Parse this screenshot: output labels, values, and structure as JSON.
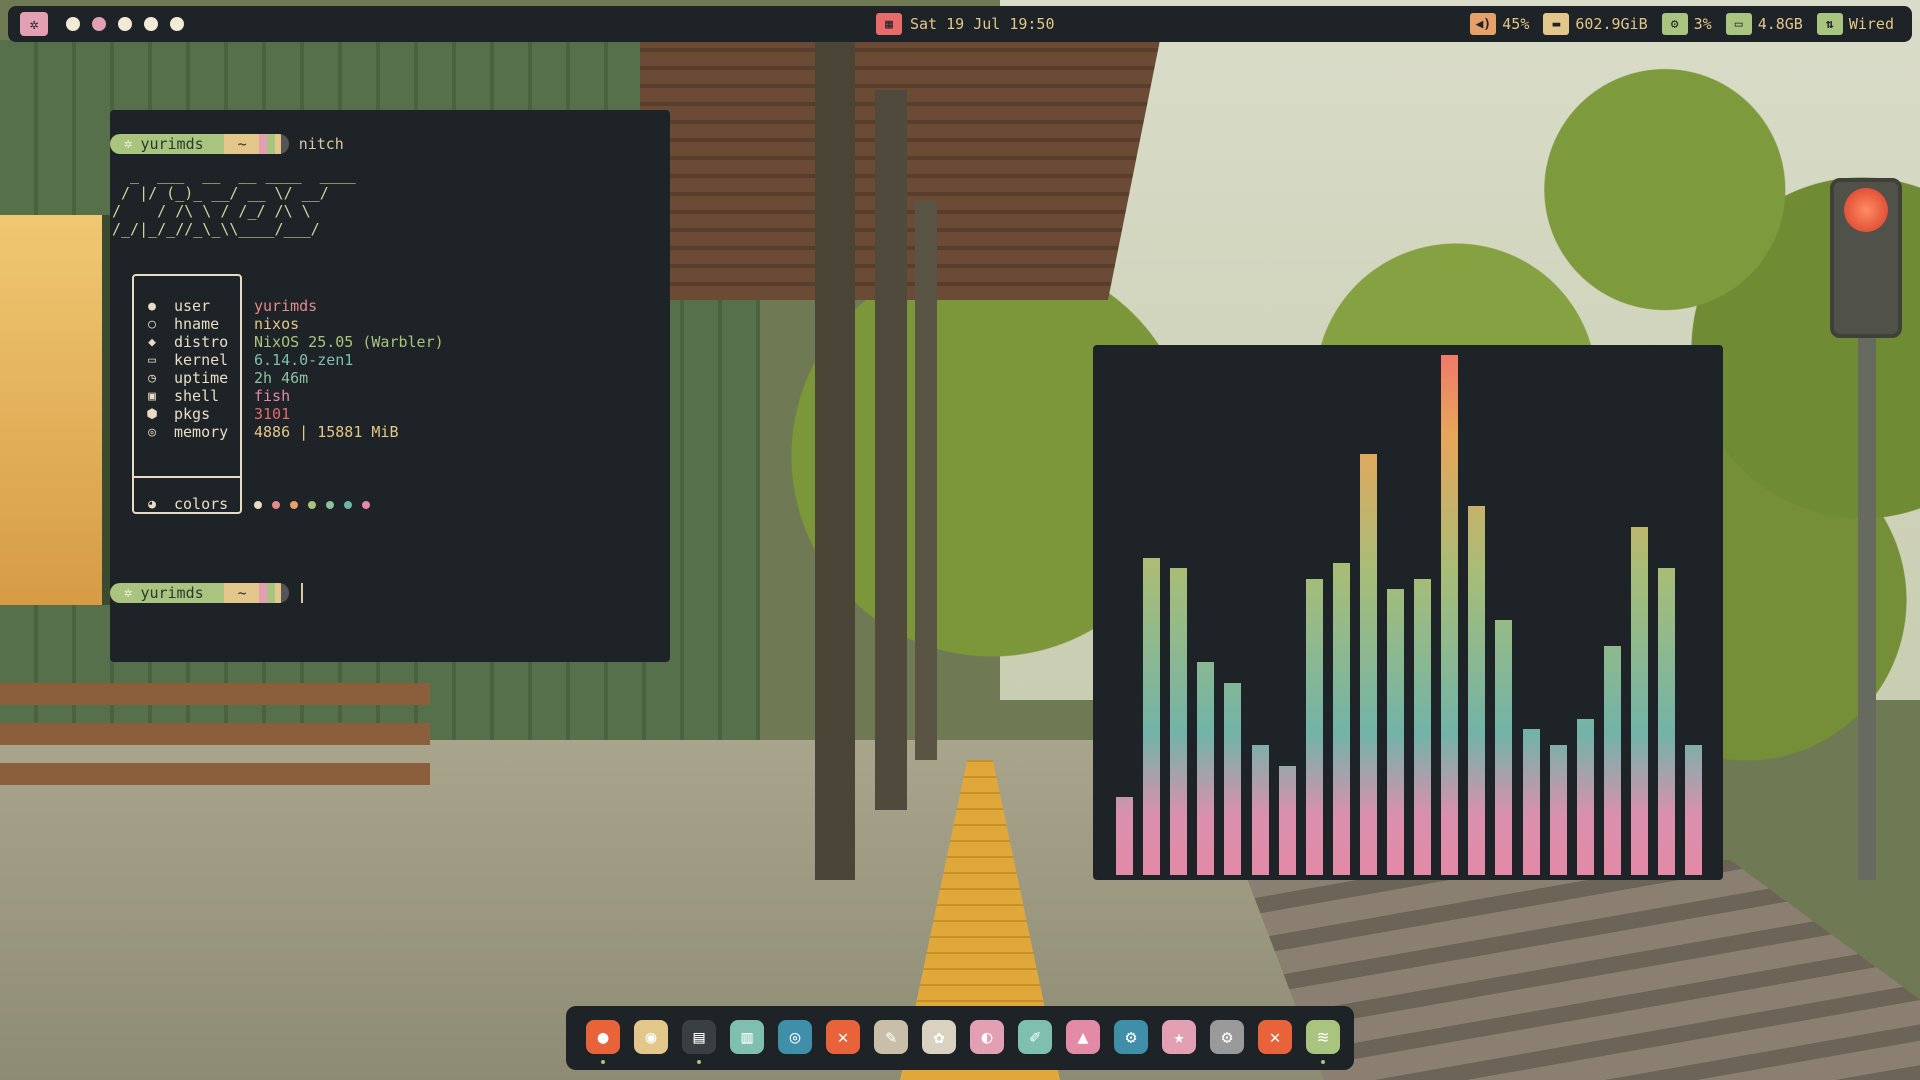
{
  "topbar": {
    "workspaces": {
      "count": 5,
      "active_index": 1
    },
    "clock": {
      "icon": "calendar-icon",
      "text": "Sat 19 Jul 19:50"
    },
    "status": [
      {
        "icon": "volume-icon",
        "value": "45%",
        "color": "#e8a06a"
      },
      {
        "icon": "disk-icon",
        "value": "602.9GiB",
        "color": "#e3c78a"
      },
      {
        "icon": "cpu-icon",
        "value": "3%",
        "color": "#a8c47e"
      },
      {
        "icon": "memory-icon",
        "value": "4.8GB",
        "color": "#a8c47e"
      },
      {
        "icon": "network-icon",
        "value": "Wired",
        "color": "#a8c47e"
      }
    ]
  },
  "terminal": {
    "prompt": {
      "user": "yurimds",
      "dir": "~"
    },
    "command": "nitch",
    "ascii_art": [
      "  _  ___  __  __ ____  ____",
      " / |/ (_)_ __/ __ \\/ __/",
      "/    / /\\ \\ / /_/ /\\ \\  ",
      "/_/|_/_//_\\_\\\\____/___/  "
    ],
    "info": [
      {
        "icon": "user-icon",
        "glyph": "●",
        "key": "user",
        "value": "yurimds",
        "color": "#e38a8a"
      },
      {
        "icon": "host-icon",
        "glyph": "○",
        "key": "hname",
        "value": "nixos",
        "color": "#e3c78a"
      },
      {
        "icon": "distro-icon",
        "glyph": "◆",
        "key": "distro",
        "value": "NixOS 25.05 (Warbler)",
        "color": "#a8c47e"
      },
      {
        "icon": "kernel-icon",
        "glyph": "▭",
        "key": "kernel",
        "value": "6.14.0-zen1",
        "color": "#7fbfb0"
      },
      {
        "icon": "uptime-icon",
        "glyph": "◷",
        "key": "uptime",
        "value": "2h 46m",
        "color": "#8fc0a0"
      },
      {
        "icon": "shell-icon",
        "glyph": "▣",
        "key": "shell",
        "value": "fish",
        "color": "#e38aa6"
      },
      {
        "icon": "package-icon",
        "glyph": "⬢",
        "key": "pkgs",
        "value": "3101",
        "color": "#e86a6a"
      },
      {
        "icon": "memory-icon",
        "glyph": "◎",
        "key": "memory",
        "value": "4886 | 15881 MiB",
        "color": "#e3c78a"
      }
    ],
    "colors_row": {
      "icon": "palette-icon",
      "key": "colors",
      "palette": [
        "#e8dcc4",
        "#e38a8a",
        "#e8a06a",
        "#a8c47e",
        "#8fc0a0",
        "#72b3a8",
        "#e38aa6"
      ]
    }
  },
  "visualizer": {
    "max_value": 1.0,
    "levels": [
      0.15,
      0.61,
      0.59,
      0.41,
      0.37,
      0.25,
      0.21,
      0.57,
      0.6,
      0.81,
      0.55,
      0.57,
      1.0,
      0.71,
      0.49,
      0.28,
      0.25,
      0.3,
      0.44,
      0.67,
      0.59,
      0.25
    ]
  },
  "dock": {
    "apps": [
      {
        "name": "firefox",
        "icon": "firefox-icon",
        "glyph": "●",
        "color": "#e8623a",
        "running": true
      },
      {
        "name": "chromium",
        "icon": "chromium-icon",
        "glyph": "◉",
        "color": "#e3c78a",
        "running": false
      },
      {
        "name": "terminal",
        "icon": "terminal-icon",
        "glyph": "▤",
        "color": "#3a3f42",
        "running": true
      },
      {
        "name": "editor",
        "icon": "editor-icon",
        "glyph": "▥",
        "color": "#7fbfb0",
        "running": false
      },
      {
        "name": "obs",
        "icon": "obs-icon",
        "glyph": "◎",
        "color": "#3f8fa8",
        "running": false
      },
      {
        "name": "app-x1",
        "icon": "close-circle-icon",
        "glyph": "✕",
        "color": "#e8623a",
        "running": false
      },
      {
        "name": "gimp",
        "icon": "gimp-icon",
        "glyph": "✎",
        "color": "#c9bfa8",
        "running": false
      },
      {
        "name": "inkscape",
        "icon": "inkscape-icon",
        "glyph": "✿",
        "color": "#d9d2c0",
        "running": false
      },
      {
        "name": "pinta",
        "icon": "paint-icon",
        "glyph": "◐",
        "color": "#e3a0b3",
        "running": false
      },
      {
        "name": "krita",
        "icon": "brush-icon",
        "glyph": "✐",
        "color": "#7fbfb0",
        "running": false
      },
      {
        "name": "blender",
        "icon": "flame-icon",
        "glyph": "▲",
        "color": "#e38aa6",
        "running": false
      },
      {
        "name": "steam",
        "icon": "steam-icon",
        "glyph": "⚙",
        "color": "#3f8fa8",
        "running": false
      },
      {
        "name": "lutris",
        "icon": "star-icon",
        "glyph": "★",
        "color": "#e3a0b3",
        "running": false
      },
      {
        "name": "settings",
        "icon": "gear-icon",
        "glyph": "⚙",
        "color": "#9a9a9a",
        "running": false
      },
      {
        "name": "app-x2",
        "icon": "close-circle-icon",
        "glyph": "✕",
        "color": "#e8623a",
        "running": false
      },
      {
        "name": "spotify",
        "icon": "spotify-icon",
        "glyph": "≋",
        "color": "#a8c47e",
        "running": true
      }
    ]
  }
}
